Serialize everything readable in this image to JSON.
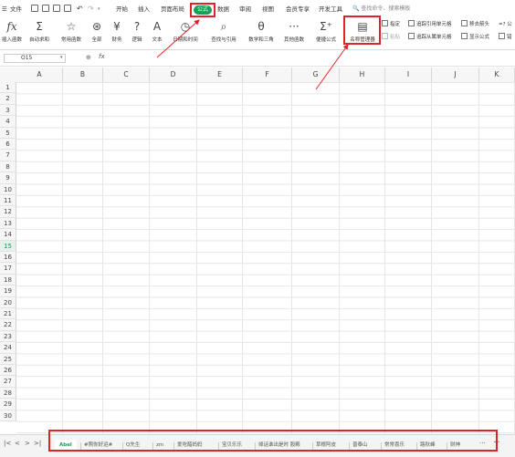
{
  "menu": {
    "file": "文件",
    "tabs": [
      "开始",
      "插入",
      "页面布局",
      "公式",
      "数据",
      "审阅",
      "视图",
      "会员专享",
      "开发工具"
    ],
    "active_tab": "公式",
    "search": "查找命令、搜索模板"
  },
  "ribbon": {
    "insert_function": "插入函数",
    "autosum": "自动求和",
    "common_functions": "常用函数",
    "all": "全部",
    "financial": "财务",
    "logical": "逻辑",
    "text": "文本",
    "datetime": "日期和时间",
    "lookup": "查找与引用",
    "math": "数学和三角",
    "other": "其他函数",
    "convenient": "便捷公式",
    "name_manager": "名称管理器",
    "define": "指定",
    "paste": "粘贴",
    "trace_precedents": "追踪引用单元格",
    "trace_dependents": "追踪从属单元格",
    "remove_arrows": "移去箭头",
    "show_formulas": "显示公式",
    "trailing_1": "=? 公",
    "trailing_2": "错"
  },
  "formula_bar": {
    "name_box": "O15",
    "zoom_icon": "zoom-icon",
    "fx": "fx",
    "value": ""
  },
  "grid": {
    "columns": [
      "A",
      "B",
      "C",
      "D",
      "E",
      "F",
      "G",
      "H",
      "I",
      "J",
      "K"
    ],
    "rows": [
      "1",
      "2",
      "3",
      "4",
      "5",
      "6",
      "7",
      "8",
      "9",
      "10",
      "11",
      "12",
      "13",
      "14",
      "15",
      "16",
      "17",
      "18",
      "19",
      "20",
      "21",
      "22",
      "23",
      "24",
      "25",
      "26",
      "27",
      "28",
      "29",
      "30"
    ],
    "active_row": "15"
  },
  "sheets": {
    "tabs": [
      "Abel",
      "#照你好运#",
      "Q先生",
      "zm",
      "爱吃醋妈妈",
      "宝贝乐乐",
      "掉话谁出是时 股殿",
      "草根阿皮",
      "普泰山",
      "常常喜乐",
      "路秋峰",
      "财神"
    ],
    "active": "Abel",
    "more": "···",
    "add": "+"
  },
  "colors": {
    "accent": "#18a058",
    "highlight": "#e0232b"
  }
}
